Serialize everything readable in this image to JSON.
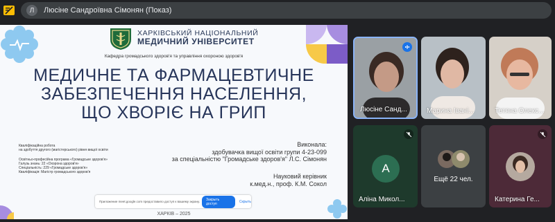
{
  "topbar": {
    "avatar_letter": "Л",
    "title": "Люсіне Сандроївна Сімонян (Показ)"
  },
  "slide": {
    "university_line1": "ХАРКІВСЬКИЙ НАЦІОНАЛЬНИЙ",
    "university_line2": "МЕДИЧНИЙ УНІВЕРСИТЕТ",
    "department": "Кафедра громадського здоров'я та управління охороною здоров'я",
    "title_line1": "МЕДИЧНЕ ТА ФАРМАЦЕВТИЧНЕ",
    "title_line2": "ЗАБЕЗПЕЧЕННЯ НАСЕЛЕННЯ,",
    "title_line3": "ЩО ХВОРІЄ НА ГРИП",
    "qual_line1": "Кваліфікаційна робота",
    "qual_line2": "на здобуття другого (магістерського) рівня вищої освіти",
    "prog_line1": "Освітньо-професійна програма «Громадське здоров'я»",
    "prog_line2": "Галузь знань: 22 «Охорона здоров'я»",
    "prog_line3": "Спеціальність: 229 «Громадське здоров'я»",
    "prog_line4": "Кваліфікація: Магістр громадського здоров'я",
    "performer_label": "Виконала:",
    "performer_line1": "здобувачка вищої освіти групи 4-23-099",
    "performer_line2": "за спеціальністю \"Громадське здоров'я\" Л.С. Сімонян",
    "supervisor_label": "Науковий керівник",
    "supervisor_name": "к.мед.н., проф. К.М. Сокол",
    "footer_city": "ХАРКІВ – 2025",
    "consent_text": "Приложение meet.google.com предоставило доступ к вашему экрану.",
    "consent_button": "Закрыть доступ",
    "consent_link": "Скрыть"
  },
  "participants": [
    {
      "name": "Люсіне Санд...",
      "mic_state": "speaking"
    },
    {
      "name": "Марина Івані..."
    },
    {
      "name": "Тетяна Олекс..."
    },
    {
      "name": "Аліна Микол...",
      "avatar_letter": "А",
      "mic_state": "muted"
    },
    {
      "name": "Ещё 22 чел."
    },
    {
      "name": "Катерина Ге...",
      "mic_state": "muted"
    }
  ],
  "colors": {
    "background": "#202124",
    "tile_green": "#1e3a2c",
    "tile_maroon": "#4d2a38",
    "tile_gray": "#3c4043",
    "accent_blue": "#1a73e8"
  }
}
